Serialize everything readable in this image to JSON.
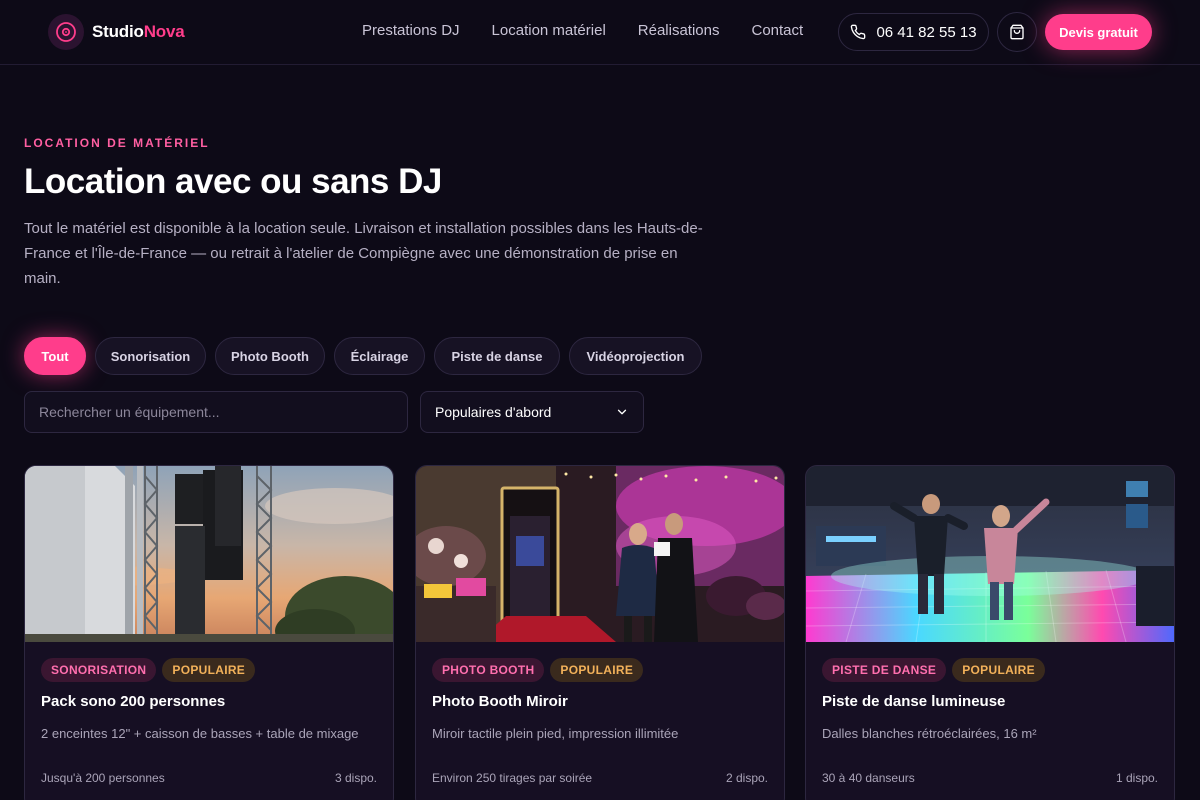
{
  "brand": {
    "name_a": "Studio",
    "name_b": "Nova"
  },
  "nav": [
    "Prestations DJ",
    "Location matériel",
    "Réalisations",
    "Contact"
  ],
  "header": {
    "phone": "06 41 82 55 13",
    "quote_label": "Devis gratuit"
  },
  "hero": {
    "eyebrow": "LOCATION DE MATÉRIEL",
    "title": "Location avec ou sans DJ",
    "lead": "Tout le matériel est disponible à la location seule. Livraison et installation possibles dans les Hauts-de-France et l'Île-de-France — ou retrait à l'atelier de Compiègne avec une démonstration de prise en main."
  },
  "filters": [
    "Tout",
    "Sonorisation",
    "Photo Booth",
    "Éclairage",
    "Piste de danse",
    "Vidéoprojection"
  ],
  "active_filter": "Tout",
  "search": {
    "placeholder": "Rechercher un équipement..."
  },
  "sort": {
    "selected": "Populaires d'abord"
  },
  "cards": [
    {
      "category": "SONORISATION",
      "badge": "POPULAIRE",
      "title": "Pack sono 200 personnes",
      "desc": "2 enceintes 12\" + caisson de basses + table de mixage",
      "capacity": "Jusqu'à 200 personnes",
      "stock": "3 dispo."
    },
    {
      "category": "PHOTO BOOTH",
      "badge": "POPULAIRE",
      "title": "Photo Booth Miroir",
      "desc": "Miroir tactile plein pied, impression illimitée",
      "capacity": "Environ 250 tirages par soirée",
      "stock": "2 dispo."
    },
    {
      "category": "PISTE DE DANSE",
      "badge": "POPULAIRE",
      "title": "Piste de danse lumineuse",
      "desc": "Dalles blanches rétroéclairées, 16 m²",
      "capacity": "30 à 40 danseurs",
      "stock": "1 dispo."
    }
  ],
  "colors": {
    "accent": "#ff3d8b",
    "background": "#0d0a17",
    "badge_popular": "#f2b15a"
  }
}
